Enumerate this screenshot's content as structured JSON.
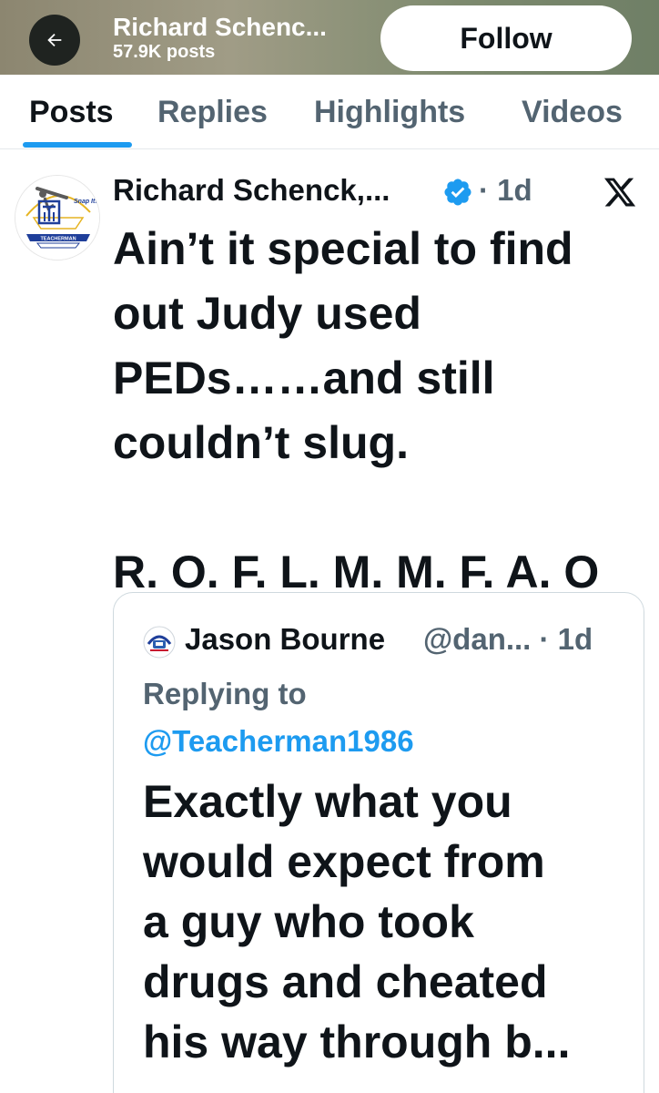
{
  "header": {
    "name": "Richard Schenc...",
    "post_count": "57.9K posts",
    "follow_label": "Follow"
  },
  "tabs": [
    {
      "label": "Posts",
      "active": true
    },
    {
      "label": "Replies",
      "active": false
    },
    {
      "label": "Highlights",
      "active": false
    },
    {
      "label": "Videos",
      "active": false
    }
  ],
  "post": {
    "author": "Richard Schenck,...",
    "time": "· 1d",
    "text": "Ain’t it special to find\nout Judy used\nPEDs……and still\ncouldn’t slug.\n\nR. O. F. L. M. M. F. A. O",
    "avatar_logo_text": "TEACHERMAN",
    "avatar_tagline": "Snap It!"
  },
  "quote": {
    "author": "Jason Bourne",
    "handle": "@dan... · 1d",
    "replying_label": "Replying to",
    "replying_handle": "@Teacherman1986",
    "text": "Exactly what you\nwould expect from\na guy who took\ndrugs and cheated\nhis way through b..."
  },
  "colors": {
    "accent": "#1d9bf0",
    "text_primary": "#0f1419",
    "text_secondary": "#536471"
  },
  "icons": [
    "back-arrow-icon",
    "verified-badge-icon",
    "x-logo-icon"
  ]
}
